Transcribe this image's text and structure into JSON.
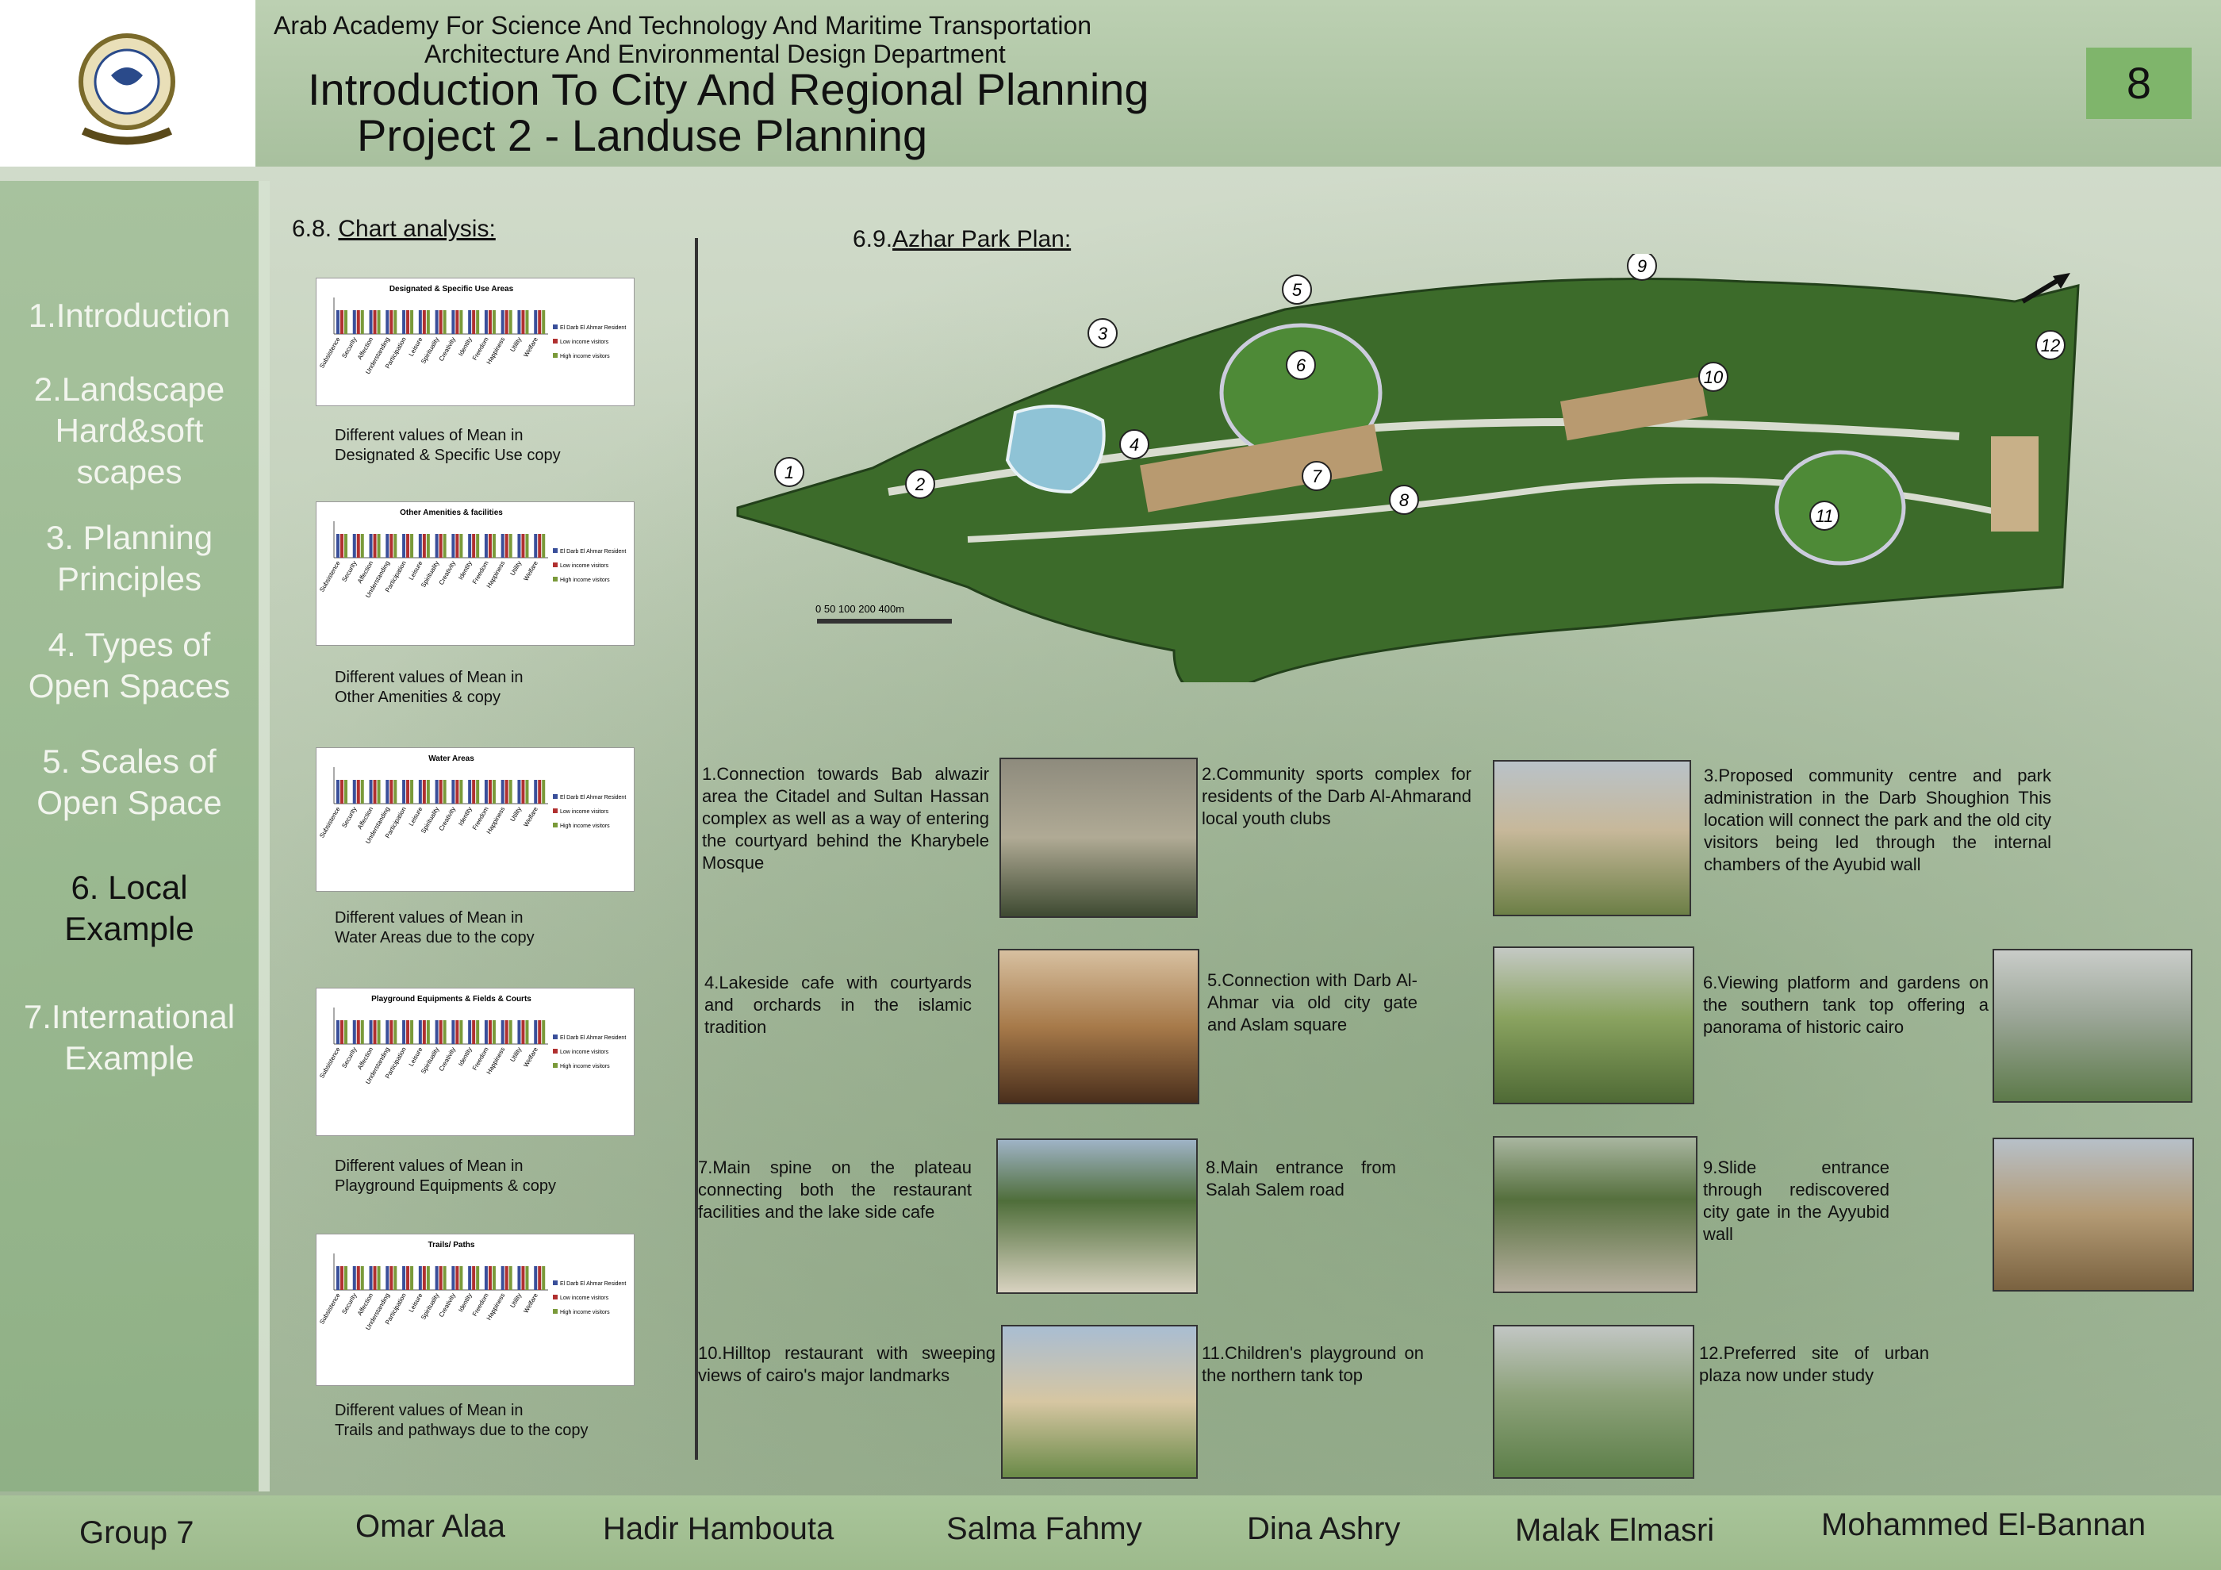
{
  "header": {
    "line1": "Arab Academy For Science And Technology And Maritime Transportation",
    "line2": "Architecture And Environmental Design Department",
    "line3": "Introduction To City And Regional Planning",
    "line4": "Project 2 - Landuse Planning",
    "page_number": "8"
  },
  "sidebar": {
    "items": [
      {
        "label": "1.Introduction"
      },
      {
        "label": "2.Landscape Hard&soft scapes"
      },
      {
        "label": "3.  Planning Principles"
      },
      {
        "label": "4.  Types of Open Spaces"
      },
      {
        "label": "5. Scales of Open Space"
      },
      {
        "label": "6.      Local Example"
      },
      {
        "label": "7.International Example"
      }
    ],
    "active_index": 5
  },
  "chart_section": {
    "number": "6.8.",
    "title": "Chart analysis:",
    "charts": [
      {
        "title": "Designated & Specific Use Areas",
        "caption_line1": "Different values of Mean in",
        "caption_line2": "Designated & Specific Use copy"
      },
      {
        "title": "Other Amenities & facilities",
        "caption_line1": "Different values of Mean in",
        "caption_line2": "Other Amenities & copy"
      },
      {
        "title": "Water Areas",
        "caption_line1": "Different values of Mean in",
        "caption_line2": "Water Areas due to the copy"
      },
      {
        "title": "Playground Equipments & Fields & Courts",
        "caption_line1": "Different values of Mean in",
        "caption_line2": "Playground Equipments & copy"
      },
      {
        "title": "Trails/ Paths",
        "caption_line1": "Different values of Mean in",
        "caption_line2": "Trails and pathways due to the copy"
      }
    ],
    "categories": [
      "Subsistence",
      "Security",
      "Affection",
      "Understanding",
      "Participation",
      "Leisure",
      "Spirituality",
      "Creativity",
      "Identity",
      "Freedom",
      "Happiness",
      "Utility",
      "Welfare"
    ],
    "legend": [
      "El Darb El Ahmar Resident",
      "Low income visitors",
      "High income visitors"
    ],
    "colors": [
      "#3a4f9a",
      "#b03030",
      "#7a9a3a"
    ]
  },
  "plan_section": {
    "number": "6.9.",
    "title": "Azhar Park Plan:",
    "scale": "0  50 100    200             400m",
    "markers": [
      "1",
      "2",
      "3",
      "4",
      "5",
      "6",
      "7",
      "8",
      "9",
      "10",
      "11",
      "12"
    ]
  },
  "items": [
    {
      "num": "1.",
      "text": "Connection towards Bab alwazir area the Citadel and Sultan Hassan complex as well as a way of entering the courtyard behind the Kharybele Mosque"
    },
    {
      "num": "2.",
      "text": "Community sports complex for residents of the Darb Al-Ahmarand local youth clubs"
    },
    {
      "num": "3.",
      "text": "Proposed community centre and park administration in the Darb Shoughion This location will connect the park and the old city visitors being led through the internal chambers of the Ayubid wall"
    },
    {
      "num": "4.",
      "text": "Lakeside cafe with courtyards and orchards in the islamic tradition"
    },
    {
      "num": "5.",
      "text": "Connection with Darb Al-Ahmar via old city gate and Aslam square"
    },
    {
      "num": "6.",
      "text": "Viewing platform and gardens on the southern tank top offering a panorama of historic cairo"
    },
    {
      "num": "7.",
      "text": "Main spine on the plateau connecting both the restaurant facilities and the lake side cafe"
    },
    {
      "num": "8.",
      "text": "Main entrance from Salah Salem road"
    },
    {
      "num": "9.",
      "text": "Slide entrance through rediscovered city gate in the Ayyubid wall"
    },
    {
      "num": "10.",
      "text": "Hilltop restaurant with sweeping views of cairo's major landmarks"
    },
    {
      "num": "11.",
      "text": "Children's playground on the northern tank top"
    },
    {
      "num": "12.",
      "text": "Preferred site of urban plaza now under study"
    }
  ],
  "footer": {
    "group": "Group 7",
    "members": [
      "Omar Alaa",
      "Hadir Hambouta",
      "Salma Fahmy",
      "Dina Ashry",
      "Malak Elmasri",
      "Mohammed El-Bannan"
    ]
  }
}
